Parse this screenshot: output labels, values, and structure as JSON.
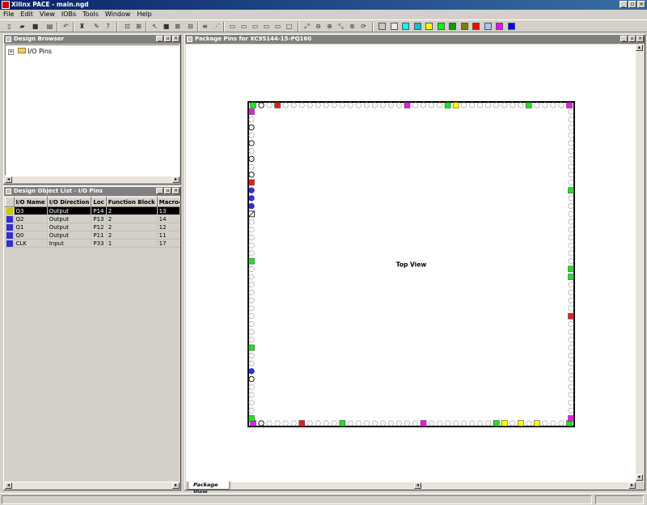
{
  "window": {
    "title": "Xilinx PACE - main.ngd"
  },
  "menu": [
    "File",
    "Edit",
    "View",
    "IOBs",
    "Tools",
    "Window",
    "Help"
  ],
  "toolbar": {
    "icons": [
      "new-icon",
      "open-icon",
      "save-icon",
      "print-icon",
      "undo-icon",
      "find-icon",
      "wrench-icon",
      "help-pointer-icon",
      "zoom-area-icon",
      "select-area-icon",
      "pointer-icon",
      "fill-icon",
      "grid-icon",
      "route-icon",
      "bank-icon",
      "dots-icon",
      "arrow-icon",
      "slash-icon",
      "fit-icon",
      "zoom-out-icon",
      "zoom-in-icon",
      "zoom-box-icon",
      "zoom-select-icon",
      "refresh-icon"
    ],
    "color_swatches": [
      "#c8c8c8",
      "#e8e8e8",
      "#00ffff",
      "#00c8c8",
      "#ffff00",
      "#00ff00",
      "#00a000",
      "#808000",
      "#ff0000",
      "#a0c8ff",
      "#ff00ff",
      "#0000ff"
    ]
  },
  "design_browser": {
    "title": "Design Browser",
    "tree": [
      {
        "label": "I/O Pins",
        "expand": "+"
      }
    ]
  },
  "object_list": {
    "title": "Design Object List - I/O Pins",
    "columns": [
      "I/O Name",
      "I/O Direction",
      "Loc",
      "Function Block",
      "Macrocell"
    ],
    "rows": [
      {
        "color": "#c8c800",
        "name": "Q3",
        "direction": "Output",
        "loc": "P14",
        "fb": "2",
        "mc": "13",
        "selected": true
      },
      {
        "color": "#3030d0",
        "name": "Q2",
        "direction": "Output",
        "loc": "P13",
        "fb": "2",
        "mc": "14",
        "selected": false
      },
      {
        "color": "#3030d0",
        "name": "Q1",
        "direction": "Output",
        "loc": "P12",
        "fb": "2",
        "mc": "12",
        "selected": false
      },
      {
        "color": "#3030d0",
        "name": "Q0",
        "direction": "Output",
        "loc": "P11",
        "fb": "2",
        "mc": "11",
        "selected": false
      },
      {
        "color": "#3030d0",
        "name": "CLK",
        "direction": "Input",
        "loc": "P33",
        "fb": "1",
        "mc": "17",
        "selected": false
      }
    ]
  },
  "package_view": {
    "title": "Package Pins for XC95144-15-PQ160",
    "center_label": "Top View",
    "tab": "Package View",
    "pins_per_side": 40,
    "colors": {
      "green": "#22e022",
      "red": "#e02020",
      "magenta": "#e020e0",
      "yellow": "#ffff00",
      "blue": "#3030e0"
    },
    "top_special": {
      "1": "green",
      "4": "red",
      "20": "magenta",
      "25": "green",
      "26": "yellow",
      "35": "green",
      "40": "magenta"
    },
    "bottom_special": {
      "1": "magenta",
      "7": "red",
      "12": "green",
      "22": "magenta",
      "31": "green",
      "32": "yellow",
      "34": "yellow",
      "36": "yellow",
      "40": "green"
    },
    "left_special": {
      "1": "magenta",
      "10": "red",
      "11": "blue",
      "12": "blue",
      "13": "blue",
      "14": "hatched",
      "20": "green",
      "31": "green",
      "34": "blue",
      "40": "green"
    },
    "right_special": {
      "11": "green",
      "21": "green",
      "22": "green",
      "27": "red",
      "40": "magenta"
    },
    "outlined_left": [
      3,
      5,
      7,
      9,
      35
    ],
    "outlined_top": [
      2
    ],
    "outlined_bottom": [
      2
    ]
  }
}
